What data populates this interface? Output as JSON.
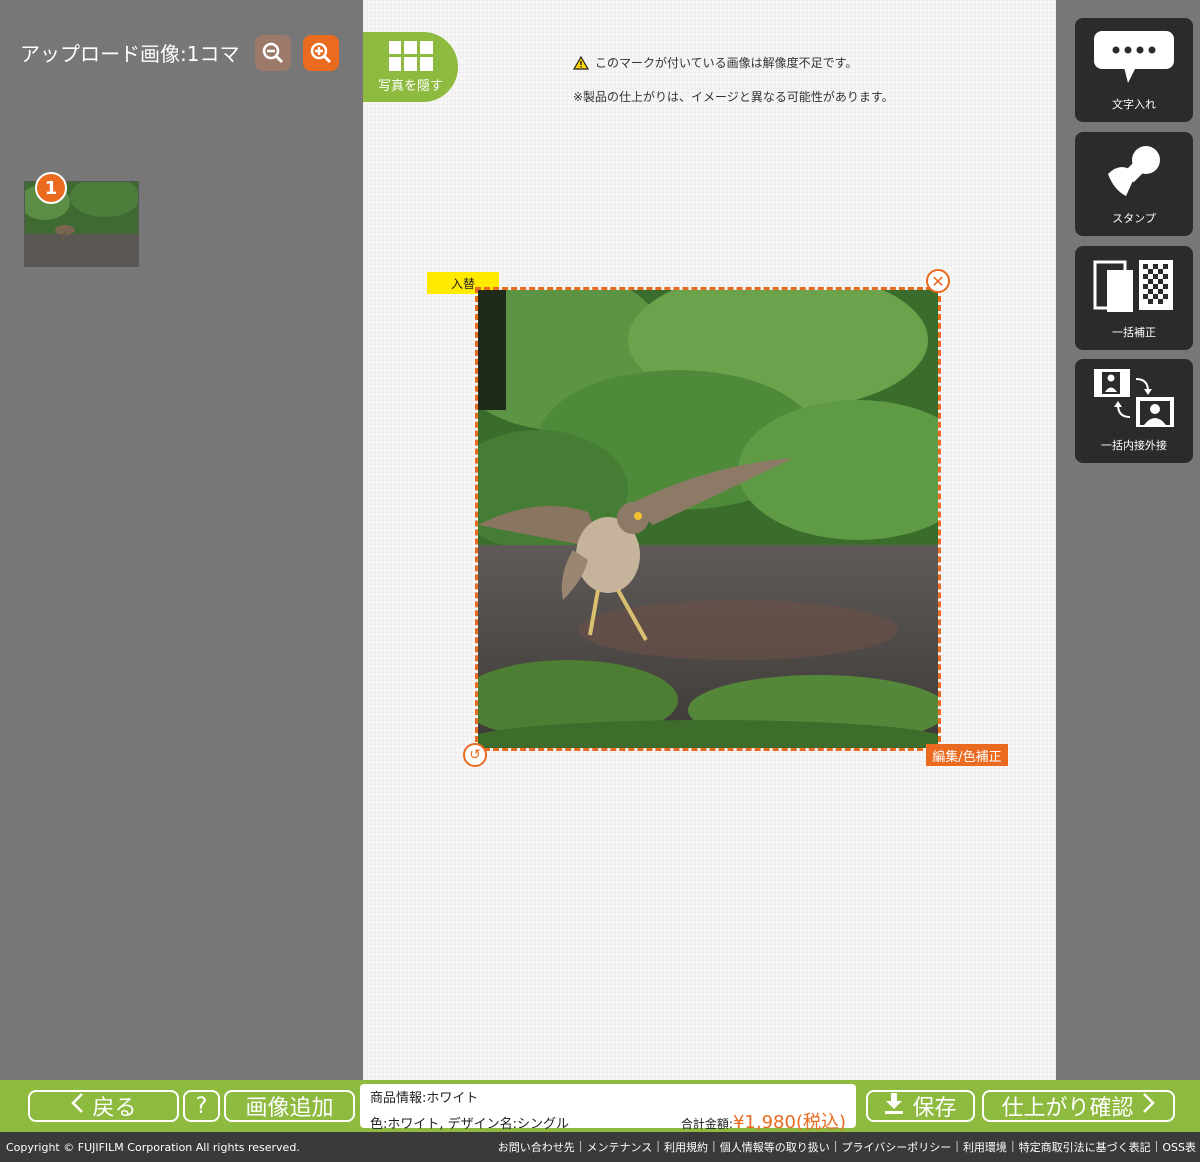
{
  "left": {
    "upload_title": "アップロード画像:1コマ",
    "thumbnail_badge": "1"
  },
  "canvas": {
    "hide_photos_label": "写真を隠す",
    "warning_text": "このマークが付いている画像は解像度不足です。",
    "note_text": "※製品の仕上がりは、イメージと異なる可能性があります。",
    "swap_label": "入替",
    "edit_label": "編集/色補正"
  },
  "tools": {
    "text_label": "文字入れ",
    "stamp_label": "スタンプ",
    "bulk_correct_label": "一括補正",
    "bulk_fit_label": "一括内接外接"
  },
  "footer": {
    "back_label": "戻る",
    "help_label": "?",
    "add_image_label": "画像追加",
    "product_info": "商品情報:ホワイト",
    "product_detail": "色:ホワイト, デザイン名:シングル",
    "total_label": "合計金額:",
    "total_value": "¥1,980(税込)",
    "save_label": "保存",
    "preview_label": "仕上がり確認"
  },
  "bottom": {
    "copyright": "Copyright © FUJIFILM Corporation All rights reserved.",
    "links": [
      "お問い合わせ先",
      "メンテナンス",
      "利用規約",
      "個人情報等の取り扱い",
      "プライバシーポリシー",
      "利用環境",
      "特定商取引法に基づく表記",
      "OSS表"
    ]
  },
  "colors": {
    "accent": "#ea6a1f",
    "green": "#8dba3f",
    "swap_yellow": "#ffea00",
    "tool_dark": "#2b2b2b"
  }
}
